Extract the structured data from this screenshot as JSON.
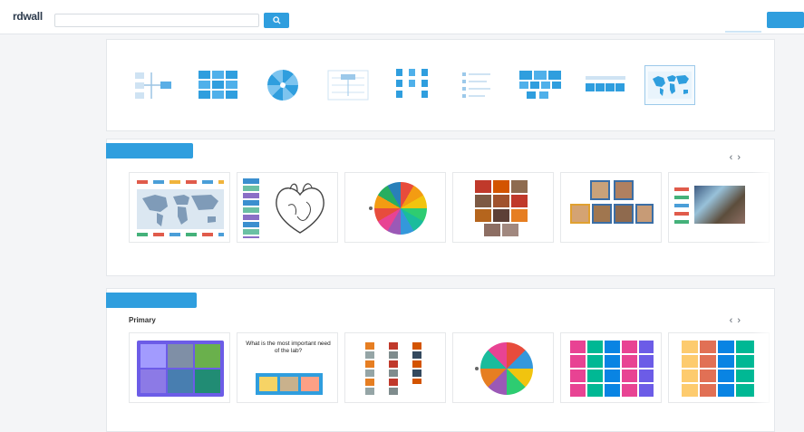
{
  "header": {
    "logo_text": "rdwall",
    "logo_sub": "",
    "search_placeholder": "",
    "search_icon": "search-icon",
    "link_label": "",
    "button_label": ""
  },
  "templates": {
    "heading": "",
    "items": [
      {
        "label": "",
        "icon": "diagram-icon"
      },
      {
        "label": "",
        "icon": "grid-icon"
      },
      {
        "label": "",
        "icon": "wheel-icon"
      },
      {
        "label": "",
        "icon": "chart-icon"
      },
      {
        "label": "",
        "icon": "bars-icon"
      },
      {
        "label": "",
        "icon": "list-icon"
      },
      {
        "label": "",
        "icon": "blocks-icon"
      },
      {
        "label": "",
        "icon": "table-icon"
      },
      {
        "label": "",
        "icon": "map-icon"
      }
    ],
    "more_label": ""
  },
  "popular": {
    "tab_label": "",
    "prev_icon": "chevron-left-icon",
    "next_icon": "chevron-right-icon",
    "cards": [
      {
        "title": "",
        "author": "",
        "meta": ""
      },
      {
        "title": "",
        "author": "",
        "meta": ""
      },
      {
        "title": "",
        "author": "",
        "meta": ""
      },
      {
        "title": "",
        "author": "",
        "meta": ""
      },
      {
        "title": "",
        "author": "",
        "meta": ""
      },
      {
        "title": "",
        "author": "",
        "meta": ""
      }
    ]
  },
  "recommended": {
    "tab_label": "",
    "heading": "Primary",
    "prev_icon": "chevron-left-icon",
    "next_icon": "chevron-right-icon",
    "cards": [
      {
        "title": "",
        "author": ""
      },
      {
        "title": "",
        "author": "",
        "thumb_text": "What is the most important need of the lab?"
      },
      {
        "title": "",
        "author": ""
      },
      {
        "title": "",
        "author": ""
      },
      {
        "title": "",
        "author": ""
      },
      {
        "title": "",
        "author": ""
      }
    ]
  },
  "colors": {
    "accent": "#2f9ede",
    "link": "#2f6fb0",
    "background": "#f4f5f7"
  }
}
